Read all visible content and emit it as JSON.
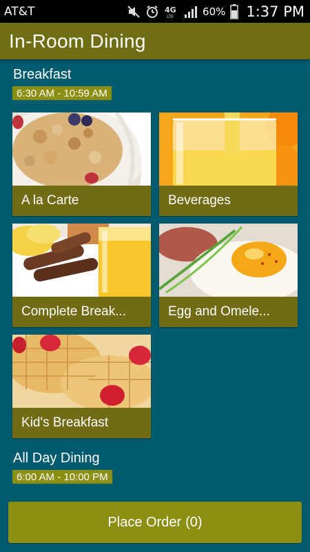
{
  "status_bar": {
    "carrier": "AT&T",
    "battery_percent": "60%",
    "time": "1:37 PM",
    "icons": [
      "mute-icon",
      "alarm-icon",
      "4g-lte-icon",
      "signal-icon",
      "battery-icon"
    ]
  },
  "header": {
    "title": "In-Room Dining"
  },
  "sections": [
    {
      "title": "Breakfast",
      "hours": "6:30 AM - 10:59 AM",
      "tiles": [
        {
          "label": "A la Carte",
          "image": "cereal-bowl-photo"
        },
        {
          "label": "Beverages",
          "image": "orange-juice-photo"
        },
        {
          "label": "Complete Break...",
          "image": "sausage-eggs-photo"
        },
        {
          "label": "Egg and Omele...",
          "image": "fried-egg-photo"
        },
        {
          "label": "Kid's Breakfast",
          "image": "waffles-strawberries-photo"
        }
      ]
    },
    {
      "title": "All Day Dining",
      "hours": "6:00 AM - 10:00 PM"
    }
  ],
  "footer": {
    "place_order_label": "Place Order",
    "order_count": "(0)"
  },
  "colors": {
    "background": "#005b6e",
    "header": "#706e14",
    "accent": "#8b8f12",
    "tile_caption": "#706b14"
  }
}
